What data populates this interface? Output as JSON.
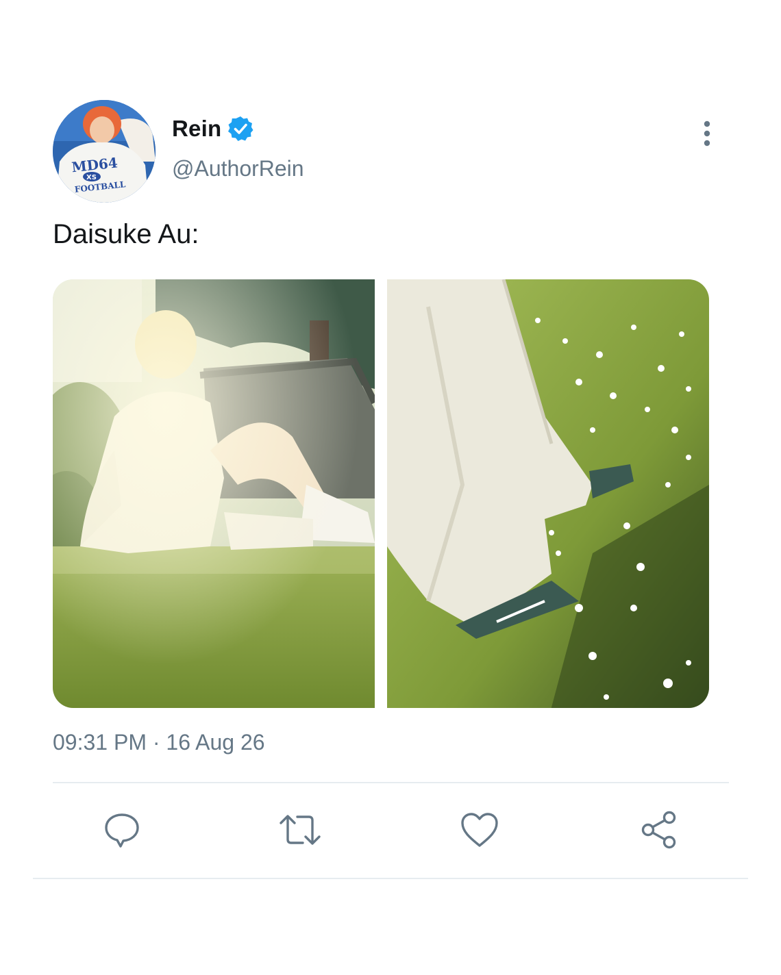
{
  "author": {
    "display_name": "Rein",
    "handle": "@AuthorRein",
    "verified": true,
    "avatar_shirt_text": "MD64",
    "avatar_badge_text": "XS",
    "avatar_sub_text": "FOOTBALL"
  },
  "tweet": {
    "text": "Daisuke Au:",
    "timestamp": "09:31 PM · 16 Aug 26"
  },
  "media": [
    {
      "kind": "photo",
      "subject": "person sitting on grass"
    },
    {
      "kind": "photo",
      "subject": "legs walking on grass with daisies"
    }
  ],
  "icons": {
    "more": "more-vertical-icon",
    "verified": "verified-badge-icon",
    "reply": "reply-icon",
    "retweet": "retweet-icon",
    "like": "heart-icon",
    "share": "share-icon"
  },
  "colors": {
    "text_primary": "#14171a",
    "text_secondary": "#657786",
    "verified_blue": "#1da1f2",
    "divider": "#e6ecf0"
  }
}
